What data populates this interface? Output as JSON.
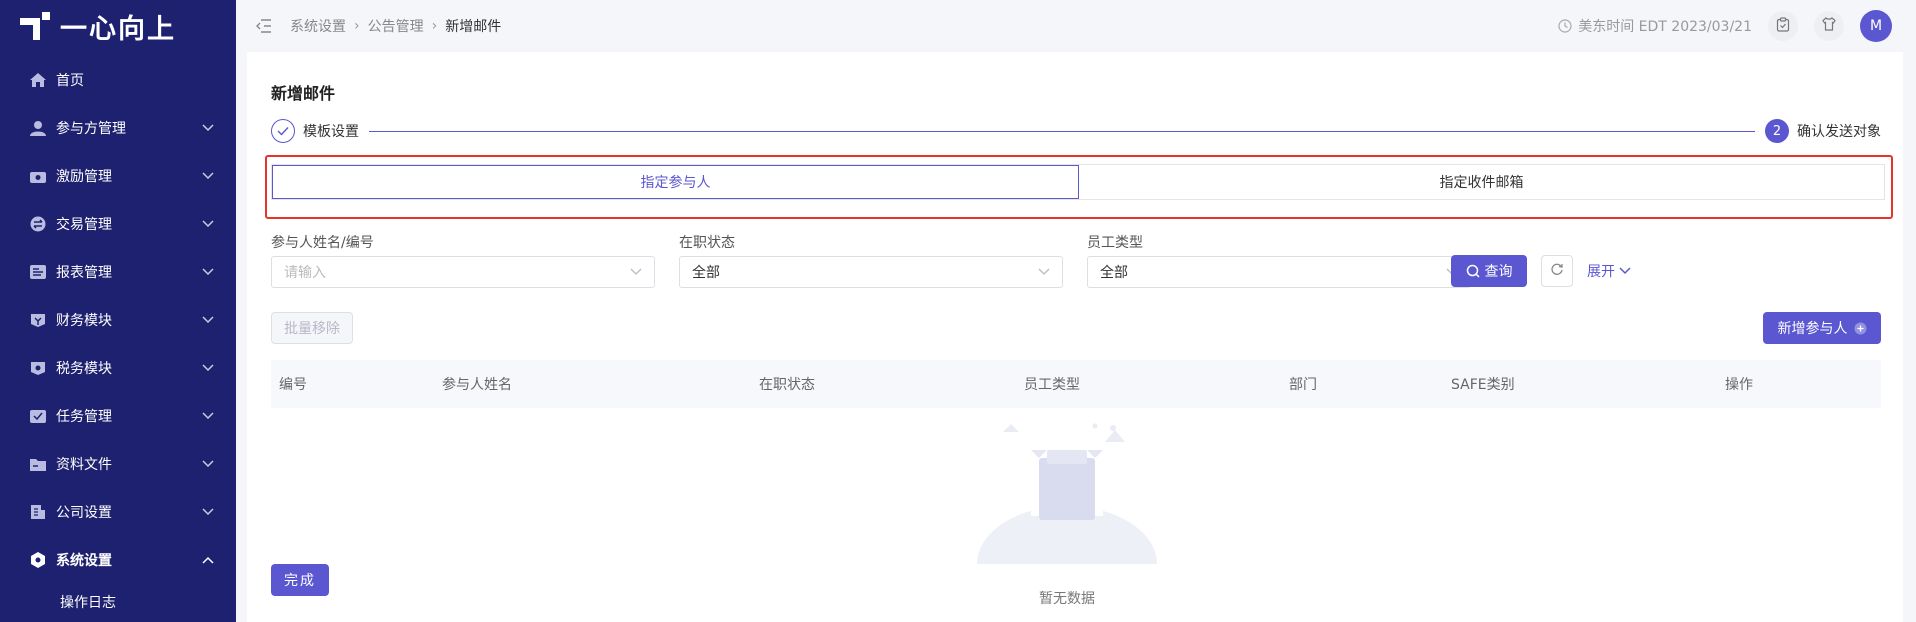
{
  "app": {
    "logo_text": "一心向上"
  },
  "sidebar": {
    "items": [
      {
        "label": "首页",
        "icon": "home-icon",
        "expandable": false
      },
      {
        "label": "参与方管理",
        "icon": "users-icon",
        "expandable": true
      },
      {
        "label": "激励管理",
        "icon": "gift-icon",
        "expandable": true
      },
      {
        "label": "交易管理",
        "icon": "exchange-icon",
        "expandable": true
      },
      {
        "label": "报表管理",
        "icon": "report-icon",
        "expandable": true
      },
      {
        "label": "财务模块",
        "icon": "finance-icon",
        "expandable": true
      },
      {
        "label": "税务模块",
        "icon": "tax-icon",
        "expandable": true
      },
      {
        "label": "任务管理",
        "icon": "task-icon",
        "expandable": true
      },
      {
        "label": "资料文件",
        "icon": "folder-icon",
        "expandable": true
      },
      {
        "label": "公司设置",
        "icon": "company-icon",
        "expandable": true
      },
      {
        "label": "系统设置",
        "icon": "settings-icon",
        "expandable": true,
        "expanded": true
      }
    ],
    "sub_item": "操作日志"
  },
  "header": {
    "breadcrumb": [
      "系统设置",
      "公告管理",
      "新增邮件"
    ],
    "time": "美东时间 EDT 2023/03/21",
    "avatar": "M"
  },
  "page": {
    "title": "新增邮件",
    "steps": [
      {
        "label": "模板设置",
        "status": "done"
      },
      {
        "label": "确认发送对象",
        "number": "2",
        "status": "active"
      }
    ],
    "tabs": [
      {
        "label": "指定参与人",
        "active": true
      },
      {
        "label": "指定收件邮箱",
        "active": false
      }
    ],
    "filters": [
      {
        "label": "参与人姓名/编号",
        "placeholder": "请输入",
        "value": ""
      },
      {
        "label": "在职状态",
        "value": "全部"
      },
      {
        "label": "员工类型",
        "value": "全部"
      }
    ],
    "query_label": "查询",
    "expand_label": "展开",
    "batch_remove_label": "批量移除",
    "add_participant_label": "新增参与人",
    "table": {
      "columns": [
        "编号",
        "参与人姓名",
        "在职状态",
        "员工类型",
        "部门",
        "SAFE类别",
        "操作"
      ],
      "rows": []
    },
    "empty_text": "暂无数据",
    "finish_label": "完成"
  },
  "colors": {
    "sidebar_bg": "#1e2170",
    "accent": "#5a57d1",
    "highlight_border": "#e8332b"
  }
}
